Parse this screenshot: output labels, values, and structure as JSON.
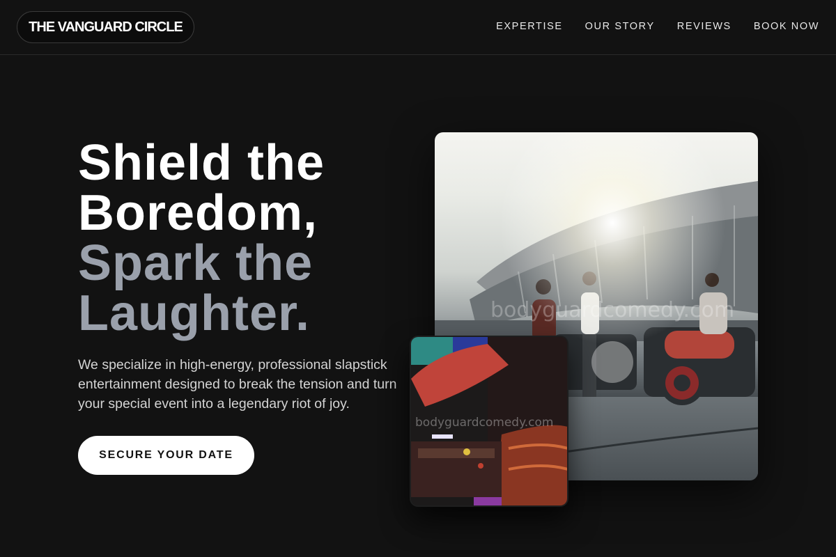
{
  "header": {
    "logo": "THE VANGUARD CIRCLE",
    "nav": [
      {
        "label": "EXPERTISE"
      },
      {
        "label": "OUR STORY"
      },
      {
        "label": "REVIEWS"
      },
      {
        "label": "BOOK NOW"
      }
    ]
  },
  "hero": {
    "headline_white_1": "Shield the",
    "headline_white_2": "Boredom,",
    "headline_gray_1": "Spark the",
    "headline_gray_2": "Laughter.",
    "subtext": "We specialize in high-energy, professional slapstick entertainment designed to break the tension and turn your special event into a legendary riot of joy.",
    "cta_label": "SECURE YOUR DATE"
  },
  "images": {
    "main_watermark": "bodyguardcomedy.com",
    "small_watermark": "bodyguardcomedy.com"
  },
  "colors": {
    "background": "#121212",
    "accent_gray": "#9aa0ab",
    "cta_background": "#ffffff"
  }
}
